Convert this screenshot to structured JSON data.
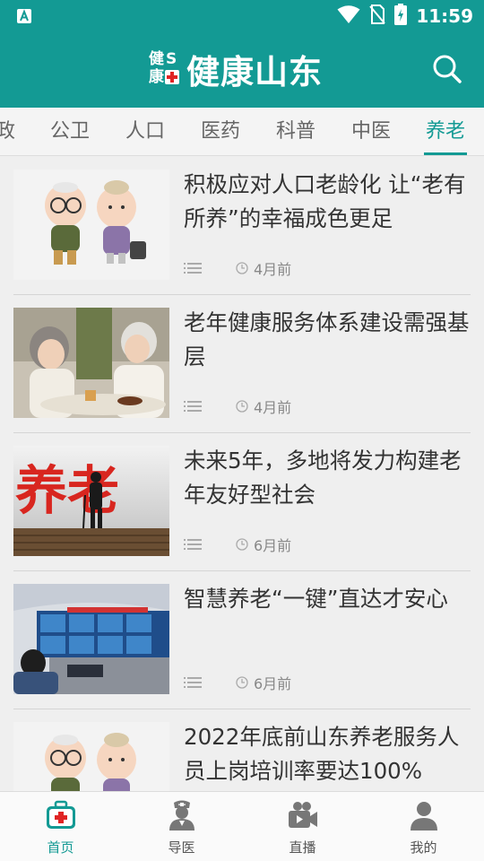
{
  "status_bar": {
    "time": "11:59",
    "icons": [
      "notification-a-icon",
      "wifi-icon",
      "no-sim-icon",
      "battery-charging-icon"
    ]
  },
  "header": {
    "logo_small_chars": [
      "健",
      "S",
      "康",
      "+"
    ],
    "logo_title": "健康山东",
    "search_icon": "search-icon",
    "accent_color": "#139a94"
  },
  "tabs": [
    {
      "label": "政"
    },
    {
      "label": "公卫"
    },
    {
      "label": "人口"
    },
    {
      "label": "医药"
    },
    {
      "label": "科普"
    },
    {
      "label": "中医"
    },
    {
      "label": "养老",
      "active": true
    }
  ],
  "articles": [
    {
      "title": "积极应对人口老龄化 让“老有所养”的幸福成色更足",
      "time": "4月前",
      "image": "elderly-couple-figurines"
    },
    {
      "title": "老年健康服务体系建设需强基层",
      "time": "4月前",
      "image": "two-elderly-women-chatting"
    },
    {
      "title": "未来5年，多地将发力构建老年友好型社会",
      "time": "6月前",
      "image": "elderly-silhouette-yanglao-characters"
    },
    {
      "title": "智慧养老“一键”直达才安心",
      "time": "6月前",
      "image": "monitoring-control-center"
    },
    {
      "title": "2022年底前山东养老服务人员上岗培训率要达100%",
      "time": "",
      "image": "elderly-couple-figurines"
    }
  ],
  "image_text": {
    "yanglao": "养老"
  },
  "bottom_nav": [
    {
      "label": "首页",
      "icon": "medical-kit-icon",
      "active": true
    },
    {
      "label": "导医",
      "icon": "nurse-icon"
    },
    {
      "label": "直播",
      "icon": "video-camera-icon"
    },
    {
      "label": "我的",
      "icon": "user-icon"
    }
  ]
}
